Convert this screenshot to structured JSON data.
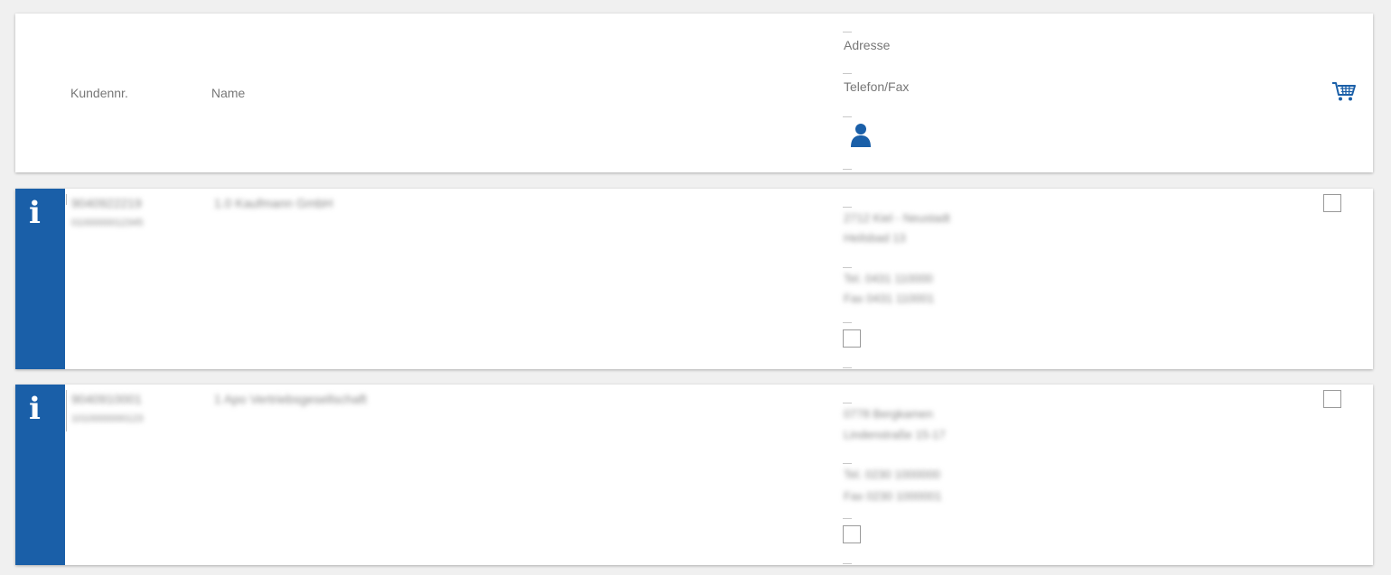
{
  "header": {
    "customer_no_label": "Kundennr.",
    "name_label": "Name",
    "address_label": "Adresse",
    "phone_fax_label": "Telefon/Fax"
  },
  "icons": {
    "cart": "shopping-cart-icon",
    "contact": "person-icon",
    "info": "info-icon"
  },
  "colors": {
    "accent": "#1a5fa8",
    "background": "#f0f0f0",
    "card": "#ffffff"
  },
  "rows": [
    {
      "info_symbol": "i",
      "customer_no": "9040922219",
      "sub_no": "0100000012345",
      "name": "1.0 Kaufmann GmbH",
      "address_line1": "2712 Kiel - Neustadt",
      "address_line2": "Heilsbad 13",
      "phone": "Tel. 0431 110000",
      "fax": "Fax 0431 110001",
      "selected": false,
      "contact_checked": false
    },
    {
      "info_symbol": "i",
      "customer_no": "9040910001",
      "sub_no": "1010000000123",
      "name": "1 Apo Vertriebsgesellschaft",
      "address_line1": "0778 Bergkamen",
      "address_line2": "Lindenstraße 15-17",
      "phone": "Tel. 0230 1000000",
      "fax": "Fax 0230 1000001",
      "selected": false,
      "contact_checked": false
    }
  ]
}
